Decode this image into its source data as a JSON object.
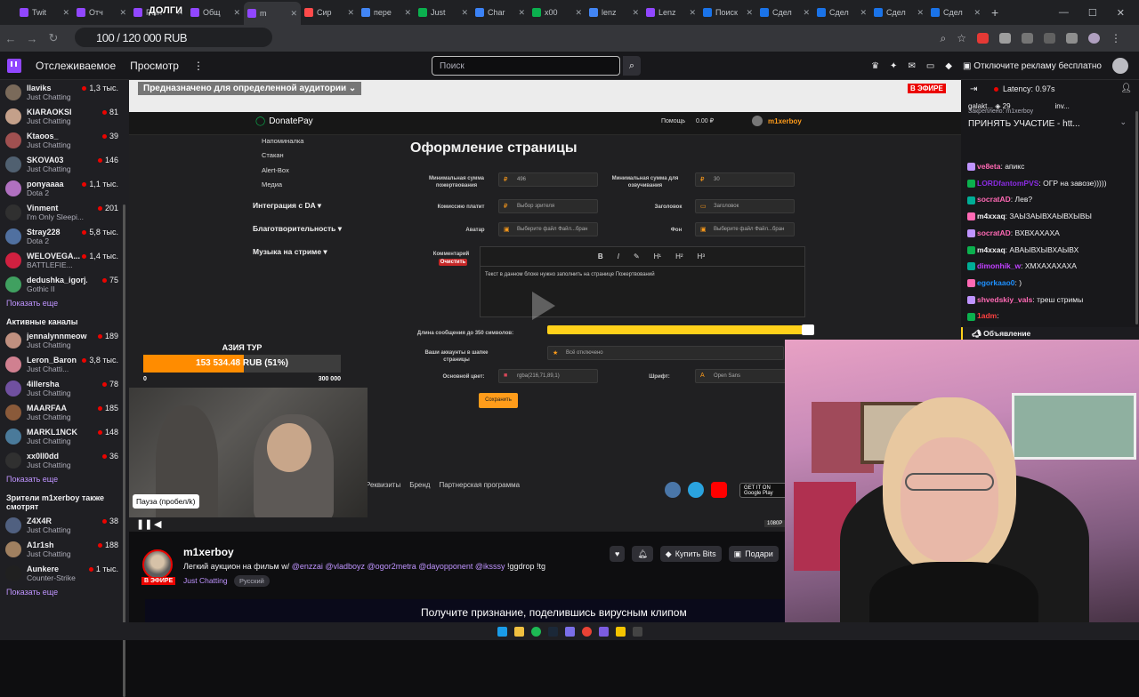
{
  "browser": {
    "tabs": [
      {
        "label": "Twit",
        "color": "#9147ff"
      },
      {
        "label": "Отч",
        "color": "#9147ff"
      },
      {
        "label": "Poin",
        "color": "#9147ff"
      },
      {
        "label": "Общ",
        "color": "#9147ff"
      },
      {
        "label": "m",
        "color": "#9147ff",
        "active": true
      },
      {
        "label": "Сир",
        "color": "#ff4a4a"
      },
      {
        "label": "пере",
        "color": "#4285f4"
      },
      {
        "label": "Just",
        "color": "#0bb04e"
      },
      {
        "label": "Char",
        "color": "#3b82f6"
      },
      {
        "label": "x00",
        "color": "#0bb04e"
      },
      {
        "label": "lenz",
        "color": "#4285f4"
      },
      {
        "label": "Lenz",
        "color": "#9147ff"
      },
      {
        "label": "Поиск",
        "color": "#1a73e8"
      },
      {
        "label": "Сдел",
        "color": "#1a73e8"
      },
      {
        "label": "Сдел",
        "color": "#1a73e8"
      },
      {
        "label": "Сдел",
        "color": "#1a73e8"
      },
      {
        "label": "Сдел",
        "color": "#1a73e8"
      }
    ],
    "overlay_text": "ДОЛГИ",
    "url_counter": "100 / 120 000 RUB"
  },
  "twitch_nav": {
    "following": "Отслеживаемое",
    "browse": "Просмотр",
    "search_placeholder": "Поиск",
    "ad_free": "Отключите рекламу бесплатно"
  },
  "sidebar": {
    "followed": [
      {
        "name": "Ilaviks",
        "game": "Just Chatting",
        "viewers": "1,3 тыс.",
        "color": "#7a6a5a"
      },
      {
        "name": "KIARAOKSI",
        "game": "Just Chatting",
        "viewers": "81",
        "color": "#c4a08a"
      },
      {
        "name": "Ktaoos_",
        "game": "Just Chatting",
        "viewers": "39",
        "color": "#a05050"
      },
      {
        "name": "SKOVA03",
        "game": "Just Chatting",
        "viewers": "146",
        "color": "#506070"
      },
      {
        "name": "ponyaaaa",
        "game": "Dota 2",
        "viewers": "1,1 тыс.",
        "color": "#b070c0"
      },
      {
        "name": "Vinment",
        "game": "I'm Only Sleepi...",
        "viewers": "201",
        "color": "#303030"
      },
      {
        "name": "Stray228",
        "game": "Dota 2",
        "viewers": "5,8 тыс.",
        "color": "#5070a0"
      },
      {
        "name": "WELOVEGA...",
        "game": "BATTLEFIE...",
        "viewers": "1,4 тыс.",
        "color": "#d02040"
      },
      {
        "name": "dedushka_igorj...",
        "game": "Gothic II",
        "viewers": "75",
        "color": "#40a060"
      }
    ],
    "show_more": "Показать еще",
    "active_head": "Активные каналы",
    "active": [
      {
        "name": "jennalynnmeowri",
        "game": "Just Chatting",
        "viewers": "189",
        "color": "#c09080"
      },
      {
        "name": "Leron_Baron",
        "game": "Just Chatti...",
        "viewers": "3,8 тыс.",
        "color": "#d08090"
      },
      {
        "name": "4illersha",
        "game": "Just Chatting",
        "viewers": "78",
        "color": "#7050a0"
      },
      {
        "name": "MAARFAA",
        "game": "Just Chatting",
        "viewers": "185",
        "color": "#8a5a3a"
      },
      {
        "name": "MARKL1NCK",
        "game": "Just Chatting",
        "viewers": "148",
        "color": "#4a7a9a"
      },
      {
        "name": "xx0ll0dd",
        "game": "Just Chatting",
        "viewers": "36",
        "color": "#303030"
      }
    ],
    "viewers_head": "Зрители m1xerboy также смотрят",
    "viewers_also": [
      {
        "name": "Z4X4R",
        "game": "Just Chatting",
        "viewers": "38",
        "color": "#506080"
      },
      {
        "name": "A1r1sh",
        "game": "Just Chatting",
        "viewers": "188",
        "color": "#a08060"
      },
      {
        "name": "Aunkere",
        "game": "Counter-Strike",
        "viewers": "1 тыс.",
        "color": "#202020"
      }
    ]
  },
  "player": {
    "audience_tag": "Предназначено для определенной аудитории",
    "live_tag": "В ЭФИРЕ",
    "donatepay": {
      "brand": "DonatePay",
      "help": "Помощь",
      "balance": "0.00 ₽",
      "user": "m1xerboy",
      "menu": [
        "Напоминалка",
        "Стакан",
        "Alert-Box",
        "Медиа"
      ],
      "sections": [
        "Интеграция с DA ▾",
        "Благотворительность ▾",
        "Музыка на стриме ▾"
      ],
      "page_title": "Оформление страницы",
      "fields": {
        "min_donation_label": "Минимальная сумма пожертвования",
        "min_donation_value": "496",
        "min_voice_label": "Минимальная сумма для озвучивания",
        "min_voice_value": "30",
        "commission_label": "Комиссию платит",
        "commission_value": "Выбор зрителя",
        "header_label": "Заголовок",
        "header_value": "Заголовок",
        "avatar_label": "Аватар",
        "bg_label": "Фон",
        "choose_file": "Выберите файл",
        "file_chosen": "Файл...бран",
        "comment_label": "Комментарий",
        "clear": "Очистить",
        "editor_text": "Текст в данном блоке нужно заполнить на странице Пожертвований",
        "msg_length_label": "Длина сообщения до 350 символов:",
        "accounts_label": "Ваши аккаунты в шапке страницы",
        "accounts_value": "Всё отключено",
        "main_color_label": "Основной цвет:",
        "main_color_value": "rgba(216,71,89,1)",
        "font_label": "Шрифт:",
        "font_value": "Open Sans",
        "save": "Сохранить"
      },
      "footer": [
        "Реквизиты",
        "Бренд",
        "Партнерская программа"
      ],
      "google_play": "GET IT ON Google Play"
    },
    "goal": {
      "title": "АЗИЯ ТУР",
      "progress_text": "153 534.48 RUB (51%)",
      "progress_fraction": 0.51,
      "min": "0",
      "max": "300 000"
    },
    "tooltip": "Пауза (пробел/k)",
    "quality": "1080P"
  },
  "stream_info": {
    "live_badge": "В ЭФИРЕ",
    "streamer": "m1xerboy",
    "title_prefix": "Легкий аукцион на фильм w/ ",
    "mentions": "@enzzai @vladboyz @ogor2metra @dayopponent @iksssy",
    "title_suffix": " !ggdrop !tg",
    "category": "Just Chatting",
    "tag": "Русский",
    "buy_bits": "Купить Bits",
    "share": "Подари",
    "banner": "Получите признание, поделившись вирусным клипом"
  },
  "chat": {
    "latency": "Latency: 0.97s",
    "gift1": "galakt...",
    "gift1_count": "29",
    "gift2": "inv...",
    "pinned_by": "Закреплено: m1xerboy",
    "pinned_text": "ПРИНЯТЬ УЧАСТИЕ - htt...",
    "messages": [
      {
        "user": "ve8eta",
        "text": "апикс",
        "color": "#ff69b4"
      },
      {
        "user": "LORDfantomPVS",
        "text": "ОГР на завозе)))))",
        "color": "#8a2be2"
      },
      {
        "user": "socratAD",
        "text": "Лев?",
        "color": "#ff69b4"
      },
      {
        "user": "m4xxaq",
        "text": "ЗАЫЗАЫВХАЫВХЫВЫ",
        "color": "#efeff1"
      },
      {
        "user": "socratAD",
        "text": "ВХВХАХАХА",
        "color": "#ff69b4"
      },
      {
        "user": "m4xxaq",
        "text": "АВАЫВХЫВХАЫВХ",
        "color": "#efeff1"
      },
      {
        "user": "dimonhik_w",
        "text": "ХМХАХАХАХА",
        "color": "#c040ff"
      },
      {
        "user": "egorkaao0",
        "text": ")",
        "color": "#1e90ff"
      },
      {
        "user": "shvedskiy_vals",
        "text": "треш стримы",
        "color": "#ff69b4"
      },
      {
        "user": "1adm",
        "text": "",
        "color": "#ff4040"
      }
    ],
    "announcement": "Объявление"
  },
  "colors": {
    "twitch_purple": "#9147ff",
    "live_red": "#eb0400",
    "goal_orange": "#ff8c00",
    "donatepay_orange": "#ff9c1a"
  }
}
